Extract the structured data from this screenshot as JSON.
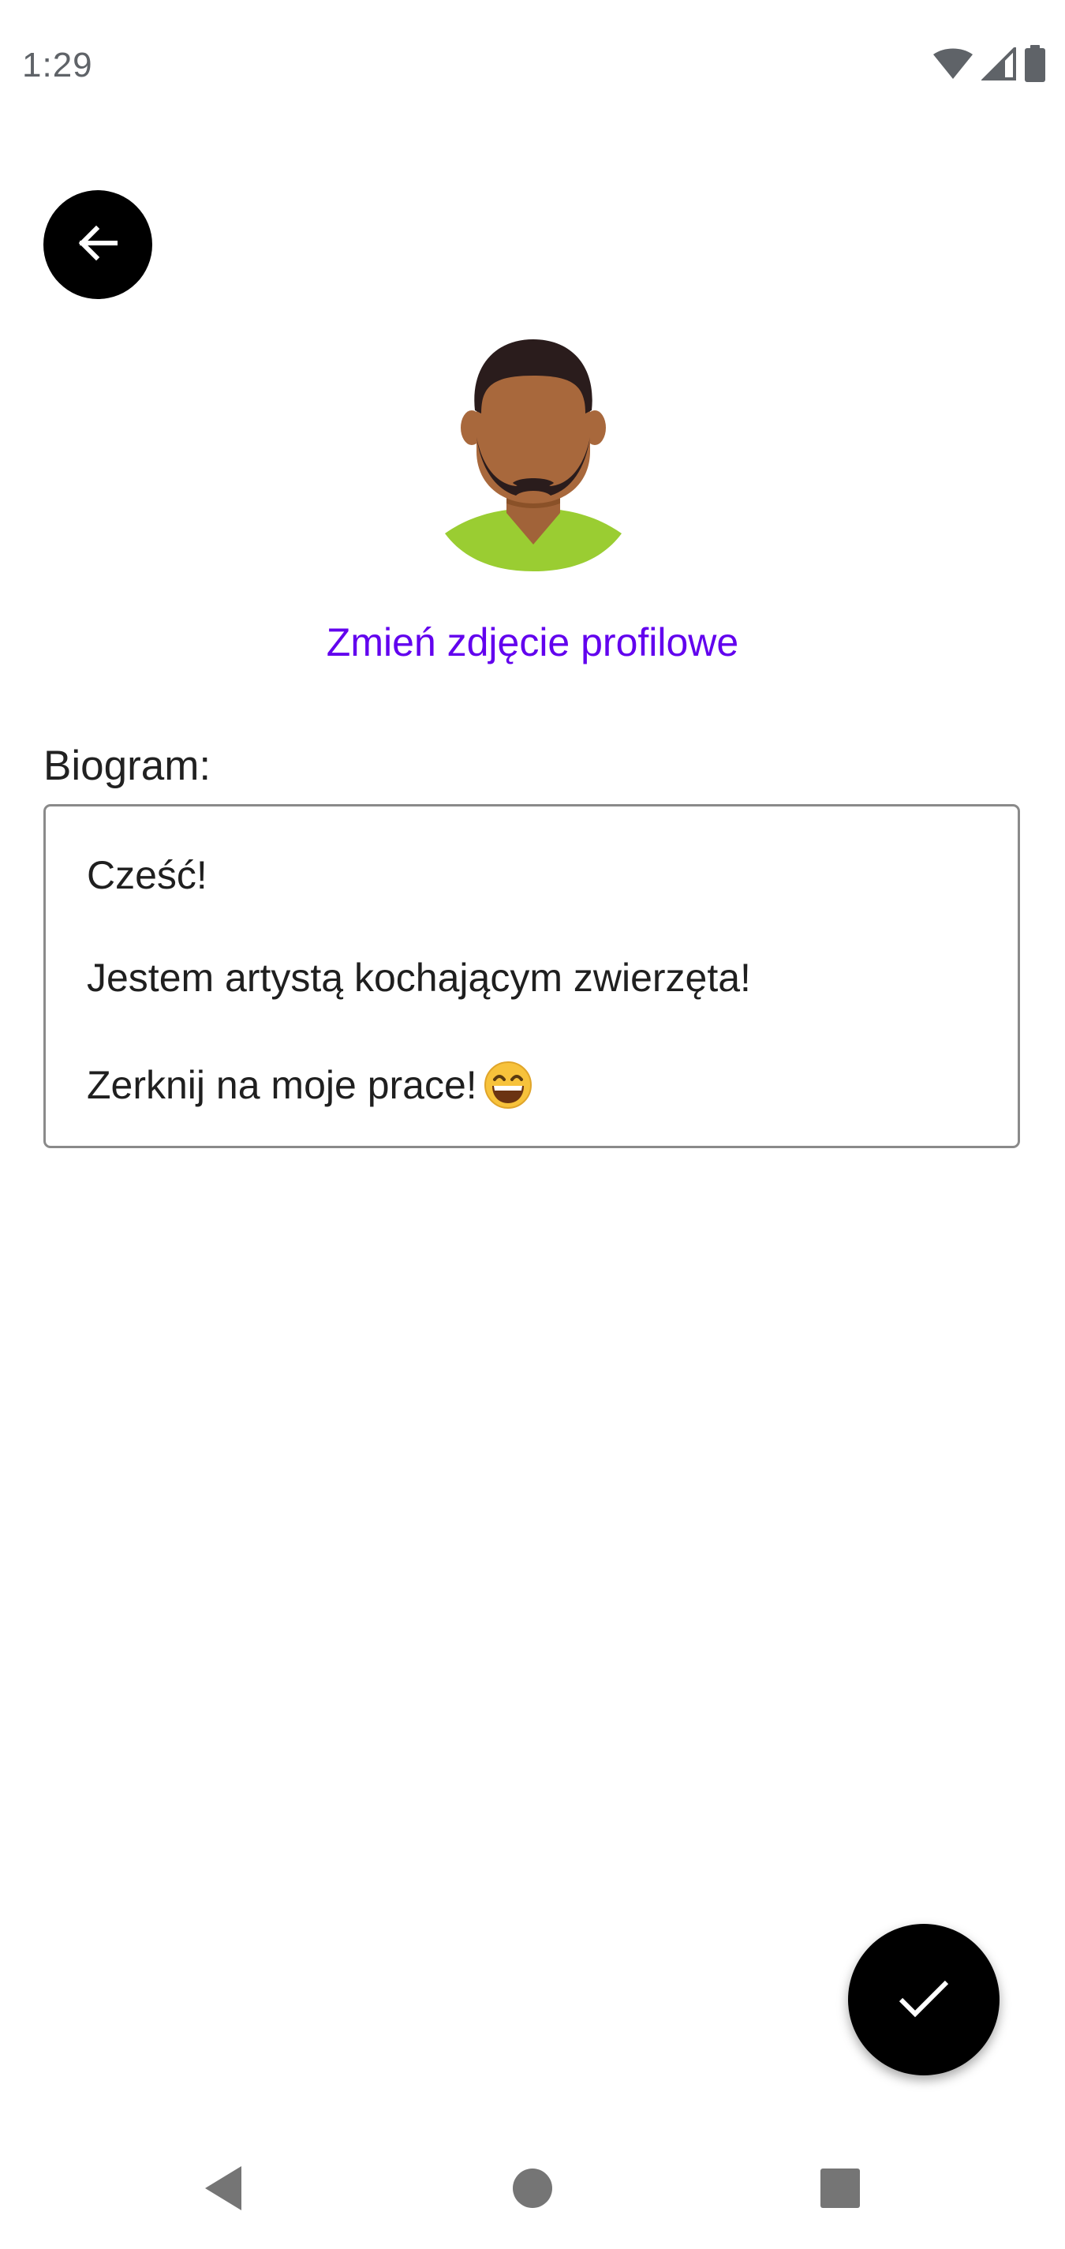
{
  "status_bar": {
    "time": "1:29",
    "icons": [
      "wifi-icon",
      "cellular-signal-icon",
      "battery-icon"
    ]
  },
  "header": {
    "back_icon": "arrow-left-icon"
  },
  "profile": {
    "avatar": "user-avatar",
    "change_photo_label": "Zmień zdjęcie profilowe"
  },
  "bio": {
    "label": "Biogram:",
    "lines": [
      "Cześć!",
      "Jestem artystą kochającym zwierzęta!",
      "Zerknij na moje prace!"
    ],
    "emoji": "grinning-face-emoji"
  },
  "actions": {
    "confirm_icon": "check-icon"
  },
  "navigation": {
    "items": [
      "nav-back-icon",
      "nav-home-icon",
      "nav-recents-icon"
    ]
  },
  "colors": {
    "accent": "#6200ee",
    "fab_background": "#000000",
    "back_button_background": "#000000",
    "text_primary": "#212121",
    "status_text": "#5f6368"
  }
}
